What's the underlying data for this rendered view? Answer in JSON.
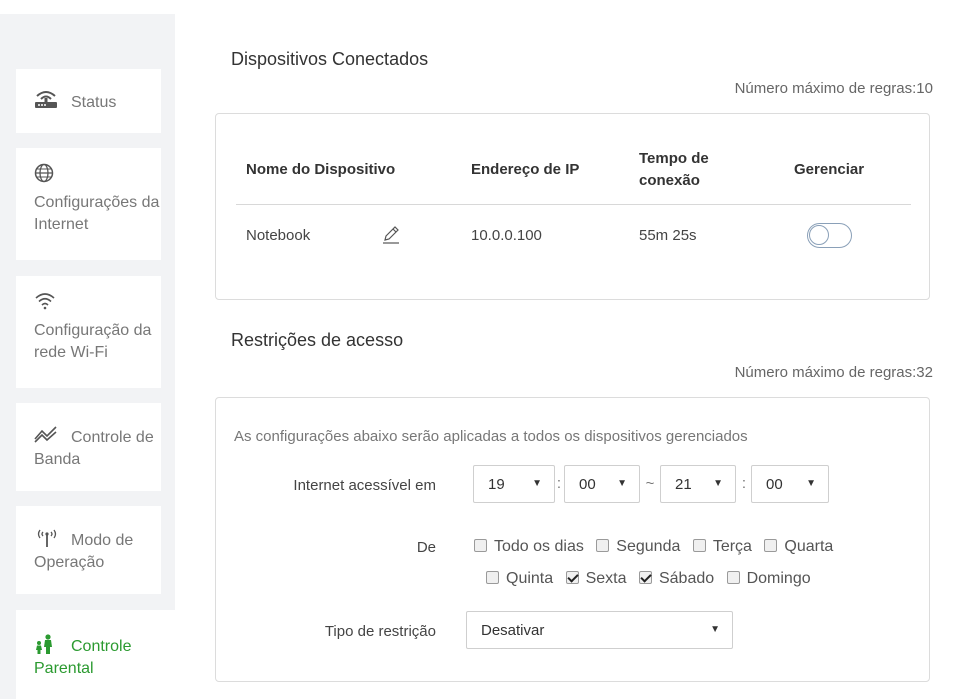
{
  "sidebar": {
    "items": [
      {
        "label": "Status",
        "icon": "router-icon"
      },
      {
        "label": "Configurações da Internet",
        "icon": "globe-icon"
      },
      {
        "label": "Configuração da rede Wi-Fi",
        "icon": "wifi-icon"
      },
      {
        "label": "Controle de Banda",
        "icon": "bandwidth-icon"
      },
      {
        "label": "Modo de Operação",
        "icon": "antenna-icon"
      },
      {
        "label": "Controle Parental",
        "icon": "parent-child-icon"
      }
    ],
    "active_color": "#2b9a30"
  },
  "devices_section": {
    "title": "Dispositivos Conectados",
    "max_rules": "Número máximo de regras:10",
    "columns": [
      "Nome do Dispositivo",
      "Endereço de IP",
      "Tempo de conexão",
      "Gerenciar"
    ],
    "rows": [
      {
        "name": "Notebook",
        "ip": "10.0.0.100",
        "time": "55m 25s",
        "manage": false
      }
    ]
  },
  "restrictions_section": {
    "title": "Restrições de acesso",
    "max_rules": "Número máximo de regras:32",
    "note": "As configurações abaixo serão aplicadas a todos os dispositivos gerenciados",
    "access_label": "Internet acessível em",
    "start_hour": "19",
    "start_min": "00",
    "end_hour": "21",
    "end_min": "00",
    "colon": ":",
    "tilde": "~",
    "days_label": "De",
    "days": [
      {
        "label": "Todo os dias",
        "checked": false
      },
      {
        "label": "Segunda",
        "checked": false
      },
      {
        "label": "Terça",
        "checked": false
      },
      {
        "label": "Quarta",
        "checked": false
      },
      {
        "label": "Quinta",
        "checked": false
      },
      {
        "label": "Sexta",
        "checked": true
      },
      {
        "label": "Sábado",
        "checked": true
      },
      {
        "label": "Domingo",
        "checked": false
      }
    ],
    "restriction_type_label": "Tipo de restrição",
    "restriction_type_value": "Desativar"
  }
}
